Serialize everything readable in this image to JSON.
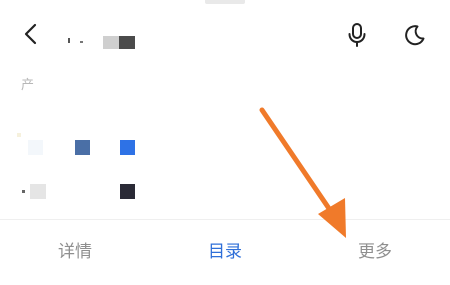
{
  "header": {
    "back_icon": "chevron-left-icon",
    "mic_icon": "microphone-icon",
    "night_icon": "moon-icon"
  },
  "settings": {
    "section_label_fragment": "产"
  },
  "tabs": [
    {
      "label": "详情",
      "active": false
    },
    {
      "label": "目录",
      "active": true
    },
    {
      "label": "更多",
      "active": false
    }
  ],
  "colors": {
    "active_tab": "#2f6fd8",
    "inactive_tab": "#8f8f8f",
    "annotation_arrow": "#f07a2a"
  }
}
